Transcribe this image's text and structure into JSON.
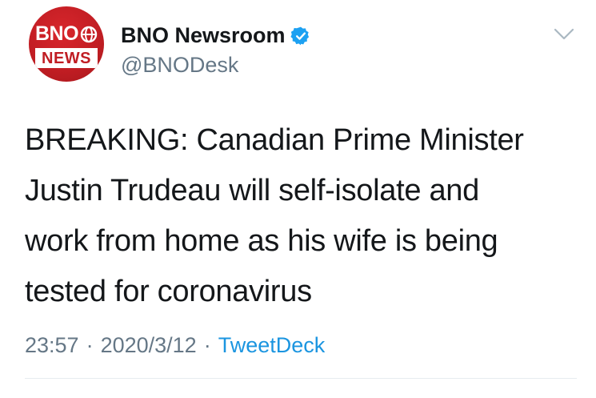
{
  "avatar": {
    "logo_top": "BNO",
    "logo_bottom": "NEWS",
    "brand_color": "#c01d23"
  },
  "header": {
    "display_name": "BNO Newsroom",
    "handle": "@BNODesk",
    "verified_icon": "verified-badge-icon",
    "menu_icon": "chevron-down-icon"
  },
  "tweet": {
    "text": "BREAKING: Canadian Prime Minister\nJustin Trudeau will self-isolate and\nwork from home as his wife is being\ntested for coronavirus"
  },
  "meta": {
    "time": "23:57",
    "date": "2020/3/12",
    "separator": "·",
    "source": "TweetDeck",
    "source_color": "#1b95e0"
  }
}
